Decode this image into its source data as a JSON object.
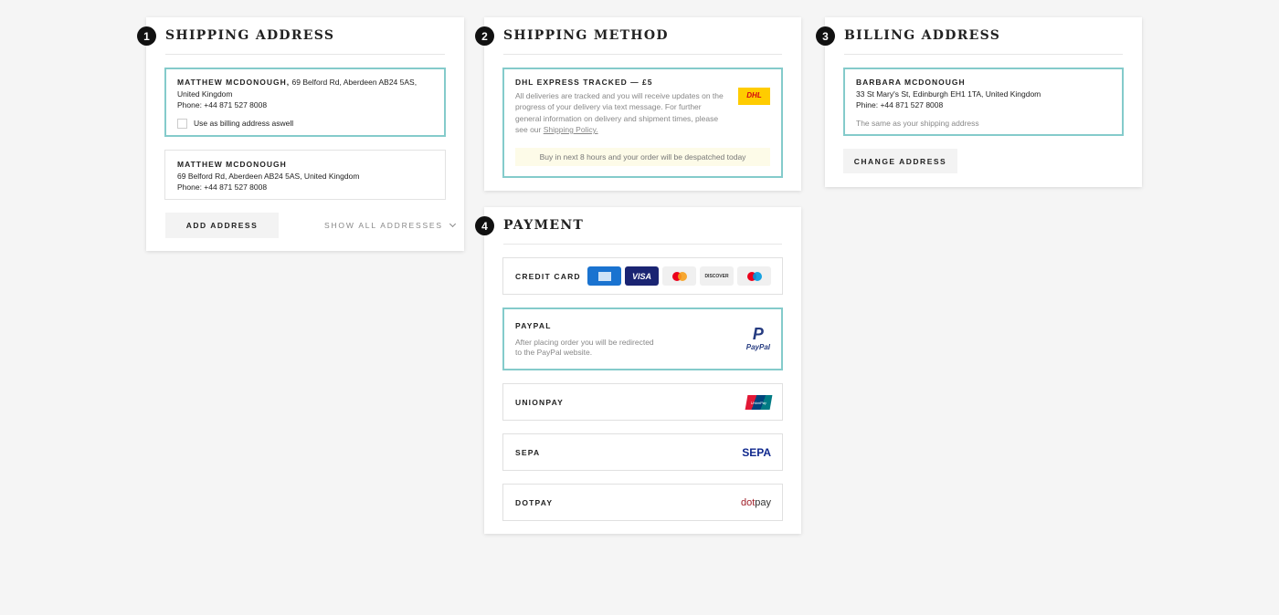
{
  "shipping_address": {
    "step": "1",
    "title": "SHIPPING ADDRESS",
    "selected": {
      "name": "MATTHEW MCDONOUGH,",
      "address": " 69 Belford Rd, Aberdeen AB24 5AS,",
      "country": "United Kingdom",
      "phone": "Phone: +44 871 527 8008",
      "checkbox_label": "Use as billing address aswell",
      "checked": false
    },
    "other": {
      "name": "MATTHEW MCDONOUGH",
      "address": "69 Belford Rd, Aberdeen AB24 5AS, United Kingdom",
      "phone": "Phone: +44 871 527 8008"
    },
    "add_button": "ADD ADDRESS",
    "show_all": "SHOW ALL ADDRESSES"
  },
  "shipping_method": {
    "step": "2",
    "title": "SHIPPING METHOD",
    "option": "DHL EXPRESS TRACKED — £5",
    "description": "All deliveries are tracked and you will receive updates on the progress of your delivery via text message. For further general information on delivery and shipment times, please see our ",
    "policy_link": "Shipping Policy.",
    "logo": "DHL",
    "notice": "Buy in next 8 hours and your order will be despatched today"
  },
  "billing_address": {
    "step": "3",
    "title": "BILLING ADDRESS",
    "name": "BARBARA MCDONOUGH",
    "address": "33 St Mary's St, Edinburgh EH1 1TA, United Kingdom",
    "phone": "Phine: +44 871 527 8008",
    "note": "The same as your shipping address",
    "change_button": "CHANGE ADDRESS"
  },
  "payment": {
    "step": "4",
    "title": "PAYMENT",
    "credit_card": {
      "label": "CREDIT CARD",
      "cards": [
        "AMEX",
        "VISA",
        "Mastercard",
        "DISCOVER",
        "Maestro"
      ]
    },
    "paypal": {
      "label": "PAYPAL",
      "description": "After placing order you will be redirected",
      "description2": "to the PayPal website.",
      "logo": "PayPal",
      "selected": true
    },
    "unionpay": {
      "label": "UNIONPAY",
      "logo": "UnionPay"
    },
    "sepa": {
      "label": "SEPA",
      "logo": "SEPA"
    },
    "dotpay": {
      "label": "DOTPAY",
      "logo_a": "dot",
      "logo_b": "pay"
    }
  },
  "colors": {
    "accent": "#84cbcb",
    "notice_bg": "#fdfbe8",
    "dhl_yellow": "#ffcc00",
    "dhl_red": "#d40511"
  }
}
